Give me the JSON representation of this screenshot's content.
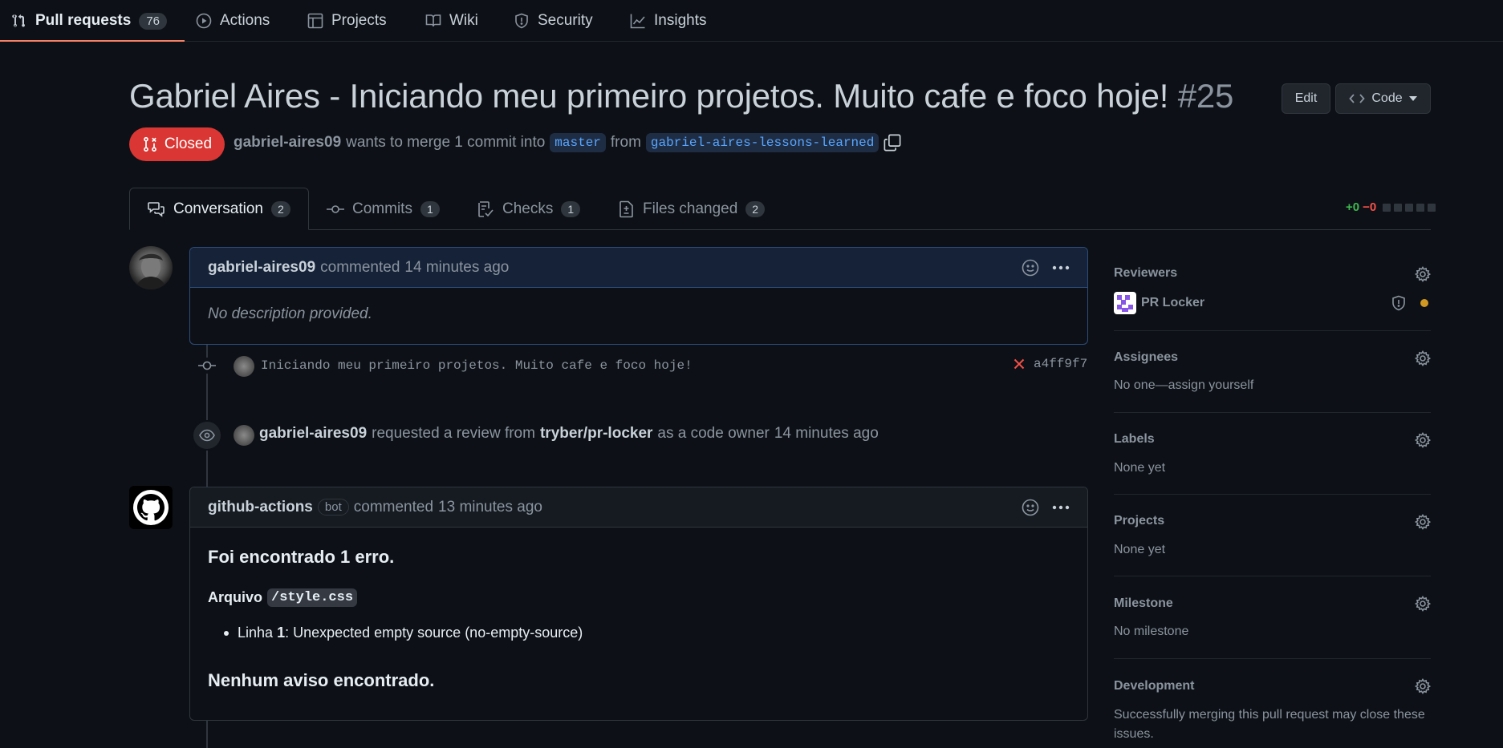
{
  "nav": {
    "items": [
      {
        "label": "Pull requests",
        "count": "76",
        "icon": "git-pull-request-icon"
      },
      {
        "label": "Actions",
        "icon": "play-icon"
      },
      {
        "label": "Projects",
        "icon": "table-icon"
      },
      {
        "label": "Wiki",
        "icon": "book-icon"
      },
      {
        "label": "Security",
        "icon": "shield-icon"
      },
      {
        "label": "Insights",
        "icon": "graph-icon"
      }
    ]
  },
  "pr": {
    "title": "Gabriel Aires - Iniciando meu primeiro projetos. Muito cafe e foco hoje!",
    "number": "#25",
    "state": "Closed",
    "author": "gabriel-aires09",
    "meta_middle": "wants to merge 1 commit into",
    "base_branch": "master",
    "from_word": "from",
    "head_branch": "gabriel-aires-lessons-learned",
    "edit_label": "Edit",
    "code_label": "Code"
  },
  "tabs": [
    {
      "label": "Conversation",
      "count": "2"
    },
    {
      "label": "Commits",
      "count": "1"
    },
    {
      "label": "Checks",
      "count": "1"
    },
    {
      "label": "Files changed",
      "count": "2"
    }
  ],
  "diffstat": {
    "additions": "+0",
    "deletions": "−0"
  },
  "comment1": {
    "author": "gabriel-aires09",
    "action": "commented",
    "time": "14 minutes ago",
    "body": "No description provided."
  },
  "commit": {
    "message": "Iniciando meu primeiro projetos. Muito cafe e foco hoje!",
    "sha": "a4ff9f7"
  },
  "review_event": {
    "actor": "gabriel-aires09",
    "text1": "requested a review from",
    "target": "tryber/pr-locker",
    "text2": "as a code owner",
    "time": "14 minutes ago"
  },
  "comment2": {
    "author": "github-actions",
    "badge": "bot",
    "action": "commented",
    "time": "13 minutes ago",
    "heading1": "Foi encontrado 1 erro.",
    "file_label": "Arquivo",
    "file": "/style.css",
    "line_prefix": "Linha",
    "line_num": "1",
    "line_msg": ": Unexpected empty source (no-empty-source)",
    "heading2": "Nenhum aviso encontrado."
  },
  "sidebar": {
    "reviewers_title": "Reviewers",
    "reviewer_name": "PR Locker",
    "assignees_title": "Assignees",
    "assignees_text": "No one—assign yourself",
    "labels_title": "Labels",
    "labels_text": "None yet",
    "projects_title": "Projects",
    "projects_text": "None yet",
    "milestone_title": "Milestone",
    "milestone_text": "No milestone",
    "development_title": "Development",
    "development_text": "Successfully merging this pull request may close these issues."
  },
  "colors": {
    "accent": "#f78166",
    "closed": "#da3633",
    "link": "#58a6ff",
    "additions": "#3fb950",
    "deletions": "#f85149"
  }
}
